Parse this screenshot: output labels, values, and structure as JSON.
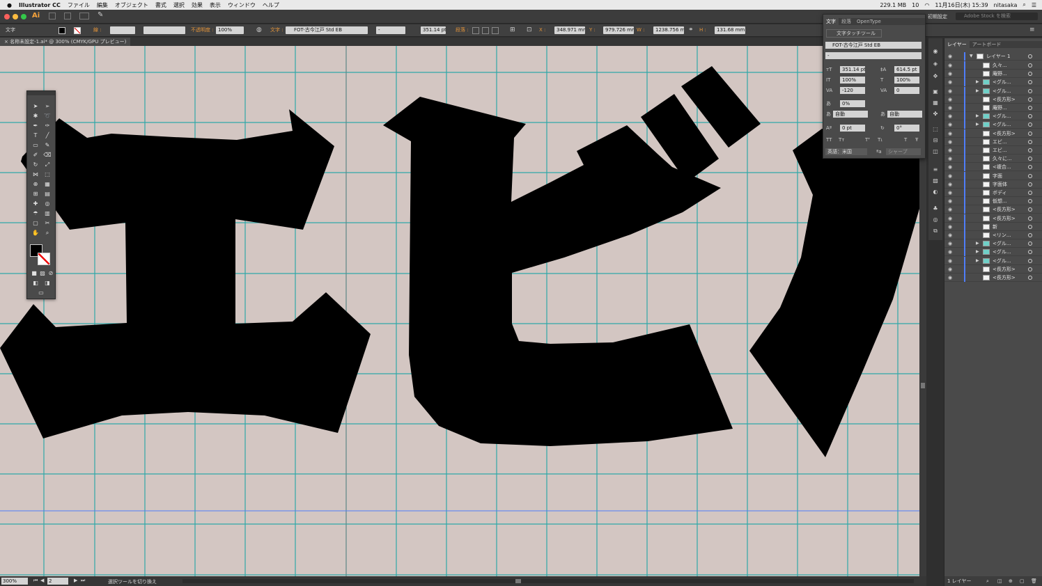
{
  "menubar": {
    "app_name": "Illustrator CC",
    "items": [
      "ファイル",
      "編集",
      "オブジェクト",
      "書式",
      "選択",
      "効果",
      "表示",
      "ウィンドウ",
      "ヘルプ"
    ],
    "memory": "229.1 MB",
    "count": "10",
    "datetime": "11月16日(木) 15:39",
    "user": "nitasaka"
  },
  "appbar": {
    "ai_logo": "Ai",
    "workspace": "初期設定",
    "stock_search_placeholder": "Adobe Stock を検索"
  },
  "control_bar": {
    "selection_label": "文字",
    "stroke_label": "線 :",
    "opacity_label": "不透明度 :",
    "opacity_value": "100%",
    "char_label": "文字 :",
    "font_name": "FOT-古今江戸 Std EB",
    "font_style": "-",
    "font_size": "351.14 pt",
    "paragraph_label": "段落 :",
    "x_label": "X :",
    "x_value": "348.971 mm",
    "y_label": "Y :",
    "y_value": "979.726 mm",
    "w_label": "W :",
    "w_value": "1238.756 m",
    "h_label": "H :",
    "h_value": "131.68 mm"
  },
  "document_tab": {
    "title": "名称未設定-1.ai* @ 300% (CMYK/GPU プレビュー)"
  },
  "canvas": {
    "glyphs_text": "エビバ",
    "background_color": "#d3c6c2",
    "grid_color": "#2fa8a8",
    "guide_color": "#4f7df9"
  },
  "character_panel": {
    "tabs": [
      "文字",
      "段落",
      "OpenType"
    ],
    "touch_tool_label": "文字タッチツール",
    "font_name": "FOT-古今江戸 Std EB",
    "font_style": "-",
    "font_size": "351.14 pt",
    "leading": "614.5 pt",
    "vertical_scale": "100%",
    "horizontal_scale": "100%",
    "kerning": "-120",
    "tracking": "0",
    "tsume": "0%",
    "aki_left": "自動",
    "aki_right": "自動",
    "baseline_shift": "0 pt",
    "rotation": "0°",
    "language": "英語：米国",
    "antialias": "シャープ"
  },
  "layers_panel": {
    "tabs": [
      "レイヤー",
      "アートボード"
    ],
    "layer_name": "レイヤー 1",
    "items": [
      {
        "name": "久々...",
        "type": "white",
        "expand": false
      },
      {
        "name": "庵野...",
        "type": "white",
        "expand": false
      },
      {
        "name": "<グル...",
        "type": "teal",
        "expand": true
      },
      {
        "name": "<グル...",
        "type": "teal",
        "expand": true
      },
      {
        "name": "<長方形>",
        "type": "white",
        "expand": false
      },
      {
        "name": "庵野...",
        "type": "white",
        "expand": false
      },
      {
        "name": "<グル...",
        "type": "teal",
        "expand": true
      },
      {
        "name": "<グル...",
        "type": "teal",
        "expand": true
      },
      {
        "name": "<長方形>",
        "type": "white",
        "expand": false
      },
      {
        "name": "エビ...",
        "type": "white",
        "expand": false
      },
      {
        "name": "エビ...",
        "type": "white",
        "expand": false
      },
      {
        "name": "久々に...",
        "type": "white",
        "expand": false
      },
      {
        "name": "<複合...",
        "type": "white",
        "expand": false
      },
      {
        "name": "字面",
        "type": "white",
        "expand": false
      },
      {
        "name": "字面体",
        "type": "white",
        "expand": false
      },
      {
        "name": "ボディ",
        "type": "white",
        "expand": false
      },
      {
        "name": "仮想...",
        "type": "white",
        "expand": false
      },
      {
        "name": "<長方形>",
        "type": "white",
        "expand": false
      },
      {
        "name": "<長方形>",
        "type": "white",
        "expand": false
      },
      {
        "name": "新",
        "type": "white",
        "expand": false
      },
      {
        "name": "<リン...",
        "type": "white",
        "expand": false
      },
      {
        "name": "<グル...",
        "type": "teal",
        "expand": true
      },
      {
        "name": "<グル...",
        "type": "teal",
        "expand": true
      },
      {
        "name": "<グル...",
        "type": "teal",
        "expand": true
      },
      {
        "name": "<長方形>",
        "type": "white",
        "expand": false
      },
      {
        "name": "<長方形>",
        "type": "white",
        "expand": false
      }
    ],
    "footer_count": "1 レイヤー"
  },
  "statusbar": {
    "zoom": "300%",
    "artboard_no": "2",
    "tool_status": "選択ツールを切り換え"
  }
}
